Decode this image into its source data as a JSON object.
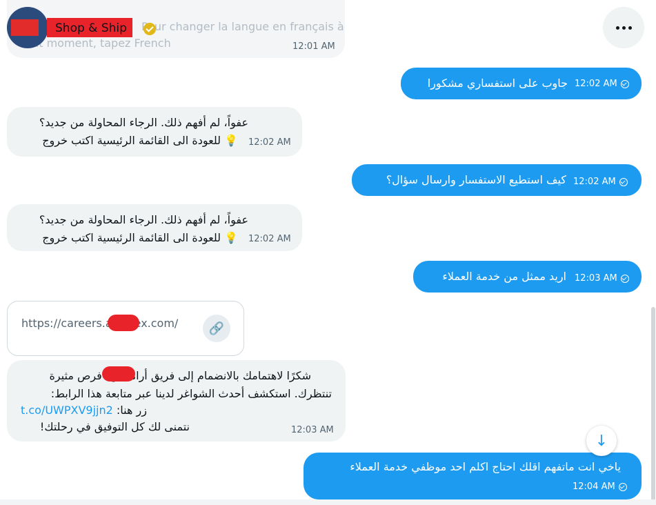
{
  "header": {
    "name": "Shop & Ship",
    "faded_line1": "Pour changer la langue en français à",
    "faded_line2": "tout moment, tapez French",
    "first_time": "12:01 AM",
    "more_icon": "more-horizontal-icon"
  },
  "messages": [
    {
      "dir": "out",
      "text": "جاوب على استفساري مشكورا",
      "time": "12:02 AM"
    },
    {
      "dir": "in",
      "line1": "عفواً، لم أفهم ذلك. الرجاء المحاولة من جديد؟",
      "line2": "💡 للعودة الى القائمة الرئيسية اكتب خروج",
      "time": "12:02 AM"
    },
    {
      "dir": "out",
      "text": "كيف استطيع الاستفسار وارسال سؤال؟",
      "time": "12:02 AM"
    },
    {
      "dir": "in",
      "line1": "عفواً، لم أفهم ذلك. الرجاء المحاولة من جديد؟",
      "line2": "💡 للعودة الى القائمة الرئيسية اكتب خروج",
      "time": "12:02 AM"
    },
    {
      "dir": "out",
      "text": "اريد ممثل من خدمة العملاء",
      "time": "12:03 AM"
    },
    {
      "dir": "in",
      "line1": "شكرًا لاهتمامك بالانضمام إلى فريق أرامكس! فرص مثيرة",
      "line2": "تنتظرك. استكشف أحدث الشواغر لدينا عبر متابعة هذا الرابط:",
      "line3": "زر هنا:",
      "link": "t.co/UWPXV9jjn2",
      "line4": "نتمنى لك كل التوفيق في رحلتك!",
      "time": "12:03 AM"
    },
    {
      "dir": "out",
      "text": "ياخي انت ماتفهم اقلك احتاج اكلم احد موظفي خدمة العملاء",
      "time": "12:04 AM"
    }
  ],
  "link_card": {
    "url": "https://careers.aramex.com/",
    "icon": "link-icon"
  },
  "scroll_icon": "arrow-down-icon"
}
